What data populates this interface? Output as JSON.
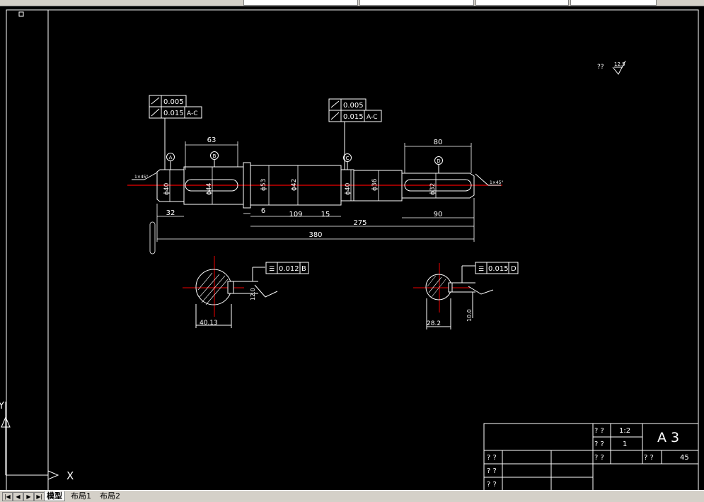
{
  "tabs": [
    {
      "label": "模型",
      "active": true
    },
    {
      "label": "布局1",
      "active": false
    },
    {
      "label": "布局2",
      "active": false
    }
  ],
  "drawing": {
    "roughness_note_label": "??",
    "roughness_note_value": "12.5",
    "tolerance_frame_left": {
      "row1_value": "0.005",
      "row2_value": "0.015",
      "row2_datum": "A-C"
    },
    "tolerance_frame_mid": {
      "row1_value": "0.005",
      "row2_value": "0.015",
      "row2_datum": "A-C"
    },
    "tolerance_frame_section_left": {
      "value": "0.012",
      "datum": "B"
    },
    "tolerance_frame_section_right": {
      "value": "0.015",
      "datum": "D"
    },
    "datum_labels": [
      "A",
      "B",
      "C",
      "D"
    ],
    "dimensions": {
      "len_63": "63",
      "len_80": "80",
      "len_32": "32",
      "len_6": "6",
      "len_109": "109",
      "len_15": "15",
      "len_275": "275",
      "len_90": "90",
      "len_380": "380",
      "dia_40a": "ϕ40",
      "dia_44": "ϕ44",
      "dia_53": "ϕ53",
      "dia_42": "ϕ42",
      "dia_40b": "ϕ40",
      "dia_36": "ϕ36",
      "dia_32": "ϕ32",
      "chamfer_left": "1×45°",
      "chamfer_right": "1×45°",
      "section_left_width": "40.13",
      "section_left_key": "12.0",
      "section_right_width": "28.2",
      "section_right_key": "10.0"
    }
  },
  "title_block": {
    "sheet_size": "A 3",
    "scale_label": "? ?",
    "scale_value": "1:2",
    "qty_label": "? ?",
    "qty_value": "1",
    "material_label": "? ?",
    "material_value": "45",
    "weight_label": "? ?",
    "row_labels": [
      "? ?",
      "? ?",
      "? ?",
      "? ?"
    ]
  },
  "ucs": {
    "y_label": "Y",
    "x_label": "X"
  }
}
